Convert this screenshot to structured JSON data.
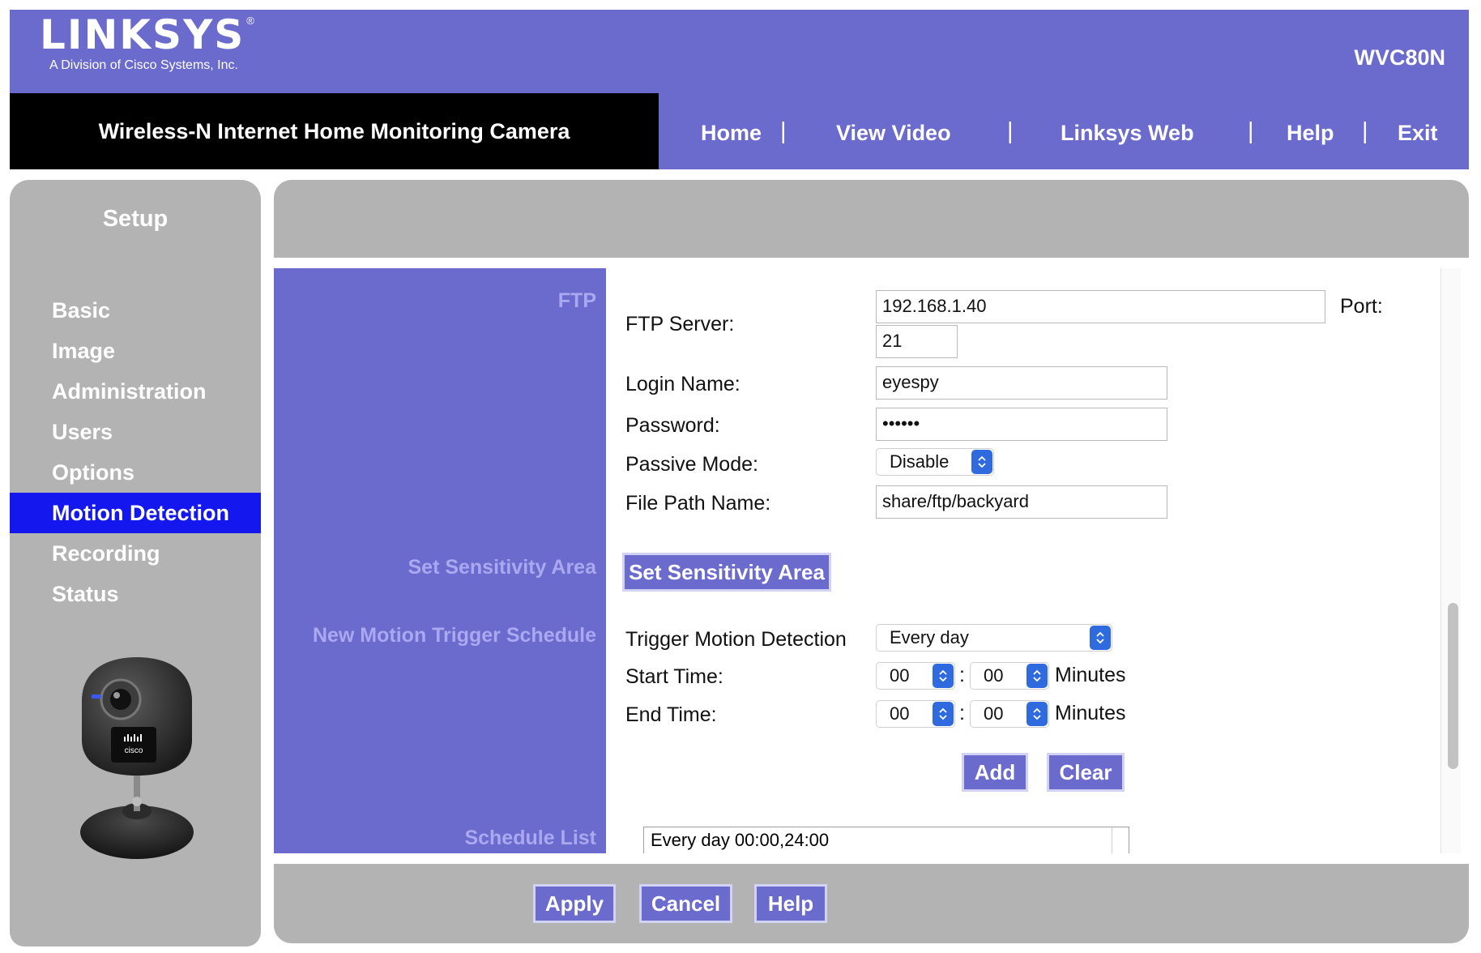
{
  "brand": {
    "logo_text": "LINKSYS",
    "logo_reg": "®",
    "logo_subtitle": "A Division of Cisco Systems, Inc.",
    "model": "WVC80N"
  },
  "header": {
    "product_title": "Wireless-N Internet Home Monitoring Camera"
  },
  "nav": {
    "home": "Home",
    "view_video": "View Video",
    "linksys_web": "Linksys Web",
    "help": "Help",
    "exit": "Exit",
    "separator": "|"
  },
  "sidebar": {
    "title": "Setup",
    "items": [
      {
        "label": "Basic"
      },
      {
        "label": "Image"
      },
      {
        "label": "Administration"
      },
      {
        "label": "Users"
      },
      {
        "label": "Options"
      },
      {
        "label": "Motion Detection",
        "active": true
      },
      {
        "label": "Recording"
      },
      {
        "label": "Status"
      }
    ],
    "camera_badge": "cisco"
  },
  "sections": {
    "ftp": "FTP",
    "sensitivity": "Set Sensitivity Area",
    "schedule": "New Motion Trigger Schedule",
    "schedule_list": "Schedule List"
  },
  "ftp": {
    "server_label": "FTP Server:",
    "server_value": "192.168.1.40",
    "port_label": "Port:",
    "port_value": "21",
    "login_label": "Login Name:",
    "login_value": "eyespy",
    "password_label": "Password:",
    "password_value": "••••••",
    "passive_label": "Passive Mode:",
    "passive_value": "Disable",
    "path_label": "File Path Name:",
    "path_value": "share/ftp/backyard"
  },
  "sensitivity": {
    "button": "Set Sensitivity Area"
  },
  "schedule": {
    "trigger_label": "Trigger Motion Detection",
    "trigger_value": "Every day",
    "start_label": "Start Time:",
    "start_hour": "00",
    "start_minute": "00",
    "end_label": "End Time:",
    "end_hour": "00",
    "end_minute": "00",
    "colon": ":",
    "minutes_label": "Minutes",
    "add_button": "Add",
    "clear_button": "Clear"
  },
  "schedule_list": {
    "entries": [
      "Every day 00:00,24:00"
    ]
  },
  "footer": {
    "apply": "Apply",
    "cancel": "Cancel",
    "help": "Help"
  },
  "colors": {
    "brand_purple": "#6b6acd",
    "active_menu": "#1418ee",
    "panel_gray": "#b3b3b3",
    "section_label": "#a9a8f0"
  }
}
